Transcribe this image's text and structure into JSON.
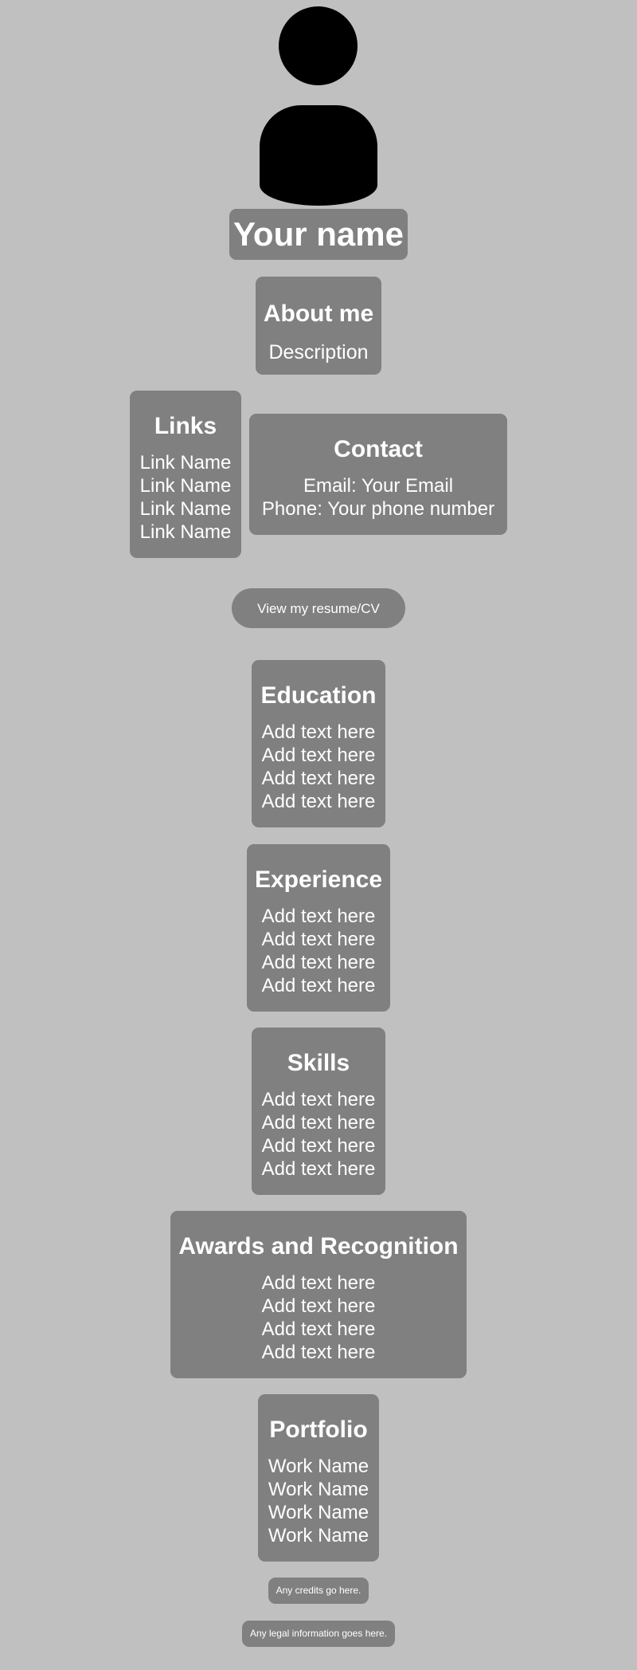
{
  "profile": {
    "avatar_icon": "person-silhouette-icon",
    "name": "Your name"
  },
  "about": {
    "title": "About me",
    "description": "Description"
  },
  "links": {
    "title": "Links",
    "items": [
      "Link Name",
      "Link Name",
      "Link Name",
      "Link Name"
    ]
  },
  "contact": {
    "title": "Contact",
    "email": "Email: Your Email",
    "phone": "Phone: Your phone number"
  },
  "resume_button": {
    "label": "View my resume/CV"
  },
  "education": {
    "title": "Education",
    "items": [
      "Add text here",
      "Add text here",
      "Add text here",
      "Add text here"
    ]
  },
  "experience": {
    "title": "Experience",
    "items": [
      "Add text here",
      "Add text here",
      "Add text here",
      "Add text here"
    ]
  },
  "skills": {
    "title": "Skills",
    "items": [
      "Add text here",
      "Add text here",
      "Add text here",
      "Add text here"
    ]
  },
  "awards": {
    "title": "Awards and Recognition",
    "items": [
      "Add text here",
      "Add text here",
      "Add text here",
      "Add text here"
    ]
  },
  "portfolio": {
    "title": "Portfolio",
    "items": [
      "Work Name",
      "Work Name",
      "Work Name",
      "Work Name"
    ]
  },
  "footer": {
    "credits": "Any credits go here.",
    "legal": "Any legal information goes here."
  },
  "colors": {
    "background": "#c0c0c0",
    "card": "#808080",
    "text": "#ffffff",
    "avatar": "#000000"
  }
}
